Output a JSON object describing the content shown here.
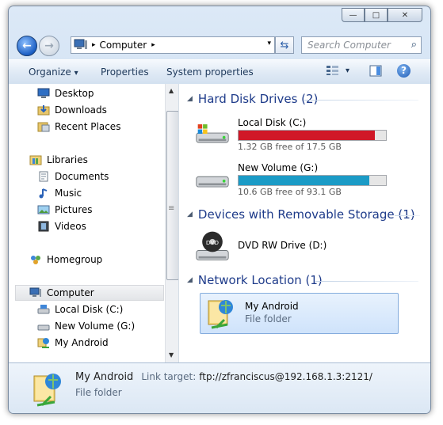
{
  "window": {
    "min": "—",
    "max": "□",
    "close": "✕"
  },
  "address": {
    "crumb_root_sep": "▸",
    "location": "Computer",
    "sep": "▸",
    "dropdown": "▾"
  },
  "search": {
    "placeholder": "Search Computer"
  },
  "toolbar": {
    "organize": "Organize",
    "organize_arrow": "▾",
    "properties": "Properties",
    "system_properties": "System properties",
    "views_arrow": "▾",
    "help": "?"
  },
  "nav": {
    "favorites": [
      {
        "label": "Desktop",
        "icon": "desktop-icon"
      },
      {
        "label": "Downloads",
        "icon": "downloads-icon"
      },
      {
        "label": "Recent Places",
        "icon": "recent-places-icon"
      }
    ],
    "libraries_label": "Libraries",
    "libraries": [
      {
        "label": "Documents",
        "icon": "documents-icon"
      },
      {
        "label": "Music",
        "icon": "music-icon"
      },
      {
        "label": "Pictures",
        "icon": "pictures-icon"
      },
      {
        "label": "Videos",
        "icon": "videos-icon"
      }
    ],
    "homegroup_label": "Homegroup",
    "computer_label": "Computer",
    "computer_items": [
      {
        "label": "Local Disk (C:)",
        "icon": "drive-icon"
      },
      {
        "label": "New Volume (G:)",
        "icon": "drive-icon"
      },
      {
        "label": "My Android",
        "icon": "network-folder-icon"
      }
    ]
  },
  "groups": {
    "hdd": "Hard Disk Drives (2)",
    "removable": "Devices with Removable Storage (1)",
    "network": "Network Location (1)"
  },
  "drives": [
    {
      "name": "Local Disk (C:)",
      "free_text": "1.32 GB free of 17.5 GB",
      "used_fraction": 0.925,
      "bar_color": "#d01827"
    },
    {
      "name": "New Volume (G:)",
      "free_text": "10.6 GB free of 93.1 GB",
      "used_fraction": 0.886,
      "bar_color": "#1b9bc6"
    }
  ],
  "dvd": {
    "name": "DVD RW Drive (D:)",
    "icon_text": "DVD"
  },
  "network_tile": {
    "name": "My Android",
    "type": "File folder"
  },
  "details": {
    "name": "My Android",
    "link_label": "Link target:",
    "link_value": "ftp://zfranciscus@192.168.1.3:2121/",
    "type": "File folder"
  },
  "colors": {
    "accent": "#1e3b8a",
    "selection": "#cfe3fb"
  }
}
